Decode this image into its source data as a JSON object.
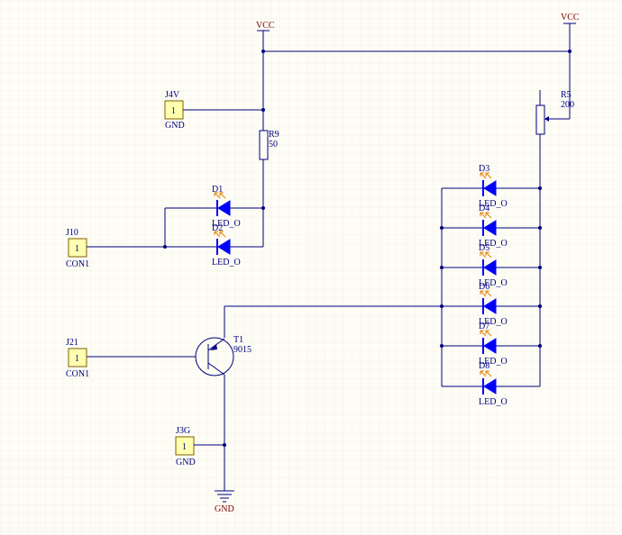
{
  "power": {
    "vcc_left": "VCC",
    "vcc_right": "VCC",
    "gnd": "GND"
  },
  "connectors": {
    "j4v": {
      "ref": "J4V",
      "pin": "1",
      "value": "GND"
    },
    "j10": {
      "ref": "J10",
      "pin": "1",
      "value": "CON1"
    },
    "j21": {
      "ref": "J21",
      "pin": "1",
      "value": "CON1"
    },
    "j3g": {
      "ref": "J3G",
      "pin": "1",
      "value": "GND"
    }
  },
  "resistors": {
    "r9": {
      "ref": "R9",
      "value": "50"
    },
    "r5": {
      "ref": "R5",
      "value": "200"
    }
  },
  "transistor": {
    "ref": "T1",
    "value": "9015"
  },
  "leds_left": [
    {
      "ref": "D1",
      "value": "LED_O"
    },
    {
      "ref": "D2",
      "value": "LED_O"
    }
  ],
  "leds_right": [
    {
      "ref": "D3",
      "value": "LED_O"
    },
    {
      "ref": "D4",
      "value": "LED_O"
    },
    {
      "ref": "D5",
      "value": "LED_O"
    },
    {
      "ref": "D6",
      "value": "LED_O"
    },
    {
      "ref": "D7",
      "value": "LED_O"
    },
    {
      "ref": "D8",
      "value": "LED_O"
    }
  ],
  "colors": {
    "wire": "#000080",
    "led": "#0000ff",
    "power_label": "#800000",
    "connector_fill": "#ffffb0",
    "light_arrows": "#e08000",
    "grid": "#e8e6dc"
  }
}
